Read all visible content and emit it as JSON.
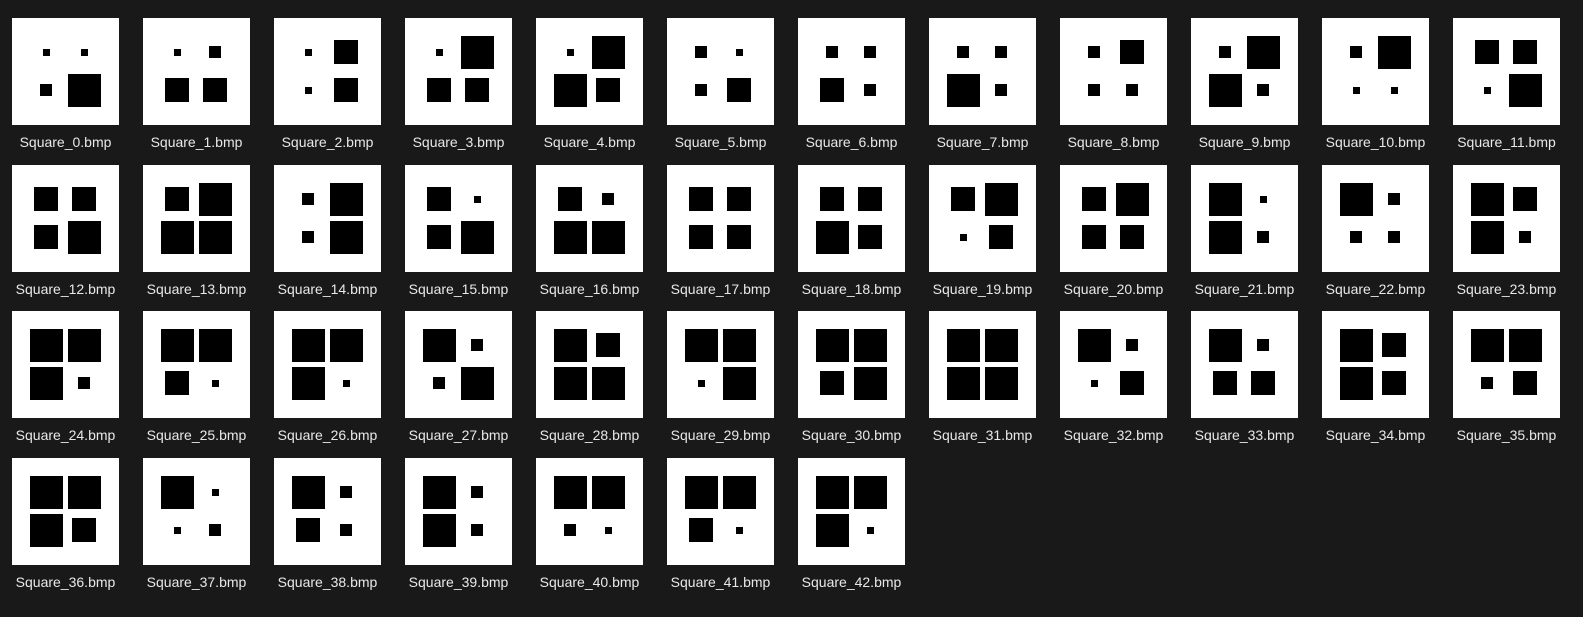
{
  "colors": {
    "background": "#191919",
    "thumbnail": "#ffffff",
    "square": "#000000",
    "label": "#e8e8e8"
  },
  "square_size_scale": [
    "small",
    "medium",
    "large",
    "xlarge"
  ],
  "files": [
    {
      "name": "Square_0.bmp",
      "squares": [
        "small",
        "small",
        "medium",
        "xlarge"
      ]
    },
    {
      "name": "Square_1.bmp",
      "squares": [
        "small",
        "medium",
        "large",
        "large"
      ]
    },
    {
      "name": "Square_2.bmp",
      "squares": [
        "small",
        "large",
        "small",
        "large"
      ]
    },
    {
      "name": "Square_3.bmp",
      "squares": [
        "small",
        "xlarge",
        "large",
        "large"
      ]
    },
    {
      "name": "Square_4.bmp",
      "squares": [
        "small",
        "xlarge",
        "xlarge",
        "large"
      ]
    },
    {
      "name": "Square_5.bmp",
      "squares": [
        "medium",
        "small",
        "medium",
        "large"
      ]
    },
    {
      "name": "Square_6.bmp",
      "squares": [
        "medium",
        "medium",
        "large",
        "medium"
      ]
    },
    {
      "name": "Square_7.bmp",
      "squares": [
        "medium",
        "medium",
        "xlarge",
        "medium"
      ]
    },
    {
      "name": "Square_8.bmp",
      "squares": [
        "medium",
        "large",
        "medium",
        "medium"
      ]
    },
    {
      "name": "Square_9.bmp",
      "squares": [
        "medium",
        "xlarge",
        "xlarge",
        "medium"
      ]
    },
    {
      "name": "Square_10.bmp",
      "squares": [
        "medium",
        "xlarge",
        "small",
        "small"
      ]
    },
    {
      "name": "Square_11.bmp",
      "squares": [
        "large",
        "large",
        "small",
        "xlarge"
      ]
    },
    {
      "name": "Square_12.bmp",
      "squares": [
        "large",
        "large",
        "large",
        "xlarge"
      ]
    },
    {
      "name": "Square_13.bmp",
      "squares": [
        "large",
        "xlarge",
        "xlarge",
        "xlarge"
      ]
    },
    {
      "name": "Square_14.bmp",
      "squares": [
        "medium",
        "xlarge",
        "medium",
        "xlarge"
      ]
    },
    {
      "name": "Square_15.bmp",
      "squares": [
        "large",
        "small",
        "large",
        "xlarge"
      ]
    },
    {
      "name": "Square_16.bmp",
      "squares": [
        "large",
        "medium",
        "xlarge",
        "xlarge"
      ]
    },
    {
      "name": "Square_17.bmp",
      "squares": [
        "large",
        "large",
        "large",
        "large"
      ]
    },
    {
      "name": "Square_18.bmp",
      "squares": [
        "large",
        "large",
        "xlarge",
        "large"
      ]
    },
    {
      "name": "Square_19.bmp",
      "squares": [
        "large",
        "xlarge",
        "small",
        "large"
      ]
    },
    {
      "name": "Square_20.bmp",
      "squares": [
        "large",
        "xlarge",
        "large",
        "large"
      ]
    },
    {
      "name": "Square_21.bmp",
      "squares": [
        "xlarge",
        "small",
        "xlarge",
        "medium"
      ]
    },
    {
      "name": "Square_22.bmp",
      "squares": [
        "xlarge",
        "medium",
        "medium",
        "medium"
      ]
    },
    {
      "name": "Square_23.bmp",
      "squares": [
        "xlarge",
        "large",
        "xlarge",
        "medium"
      ]
    },
    {
      "name": "Square_24.bmp",
      "squares": [
        "xlarge",
        "xlarge",
        "xlarge",
        "medium"
      ]
    },
    {
      "name": "Square_25.bmp",
      "squares": [
        "xlarge",
        "xlarge",
        "large",
        "small"
      ]
    },
    {
      "name": "Square_26.bmp",
      "squares": [
        "xlarge",
        "xlarge",
        "xlarge",
        "small"
      ]
    },
    {
      "name": "Square_27.bmp",
      "squares": [
        "xlarge",
        "medium",
        "medium",
        "xlarge"
      ]
    },
    {
      "name": "Square_28.bmp",
      "squares": [
        "xlarge",
        "large",
        "xlarge",
        "xlarge"
      ]
    },
    {
      "name": "Square_29.bmp",
      "squares": [
        "xlarge",
        "xlarge",
        "small",
        "xlarge"
      ]
    },
    {
      "name": "Square_30.bmp",
      "squares": [
        "xlarge",
        "xlarge",
        "large",
        "xlarge"
      ]
    },
    {
      "name": "Square_31.bmp",
      "squares": [
        "xlarge",
        "xlarge",
        "xlarge",
        "xlarge"
      ]
    },
    {
      "name": "Square_32.bmp",
      "squares": [
        "xlarge",
        "medium",
        "small",
        "large"
      ]
    },
    {
      "name": "Square_33.bmp",
      "squares": [
        "xlarge",
        "medium",
        "large",
        "large"
      ]
    },
    {
      "name": "Square_34.bmp",
      "squares": [
        "xlarge",
        "large",
        "xlarge",
        "large"
      ]
    },
    {
      "name": "Square_35.bmp",
      "squares": [
        "xlarge",
        "xlarge",
        "medium",
        "large"
      ]
    },
    {
      "name": "Square_36.bmp",
      "squares": [
        "xlarge",
        "xlarge",
        "xlarge",
        "large"
      ]
    },
    {
      "name": "Square_37.bmp",
      "squares": [
        "xlarge",
        "small",
        "small",
        "medium"
      ]
    },
    {
      "name": "Square_38.bmp",
      "squares": [
        "xlarge",
        "medium",
        "large",
        "medium"
      ]
    },
    {
      "name": "Square_39.bmp",
      "squares": [
        "xlarge",
        "medium",
        "xlarge",
        "medium"
      ]
    },
    {
      "name": "Square_40.bmp",
      "squares": [
        "xlarge",
        "xlarge",
        "medium",
        "small"
      ]
    },
    {
      "name": "Square_41.bmp",
      "squares": [
        "xlarge",
        "xlarge",
        "large",
        "small"
      ]
    },
    {
      "name": "Square_42.bmp",
      "squares": [
        "xlarge",
        "xlarge",
        "xlarge",
        "small"
      ]
    }
  ]
}
